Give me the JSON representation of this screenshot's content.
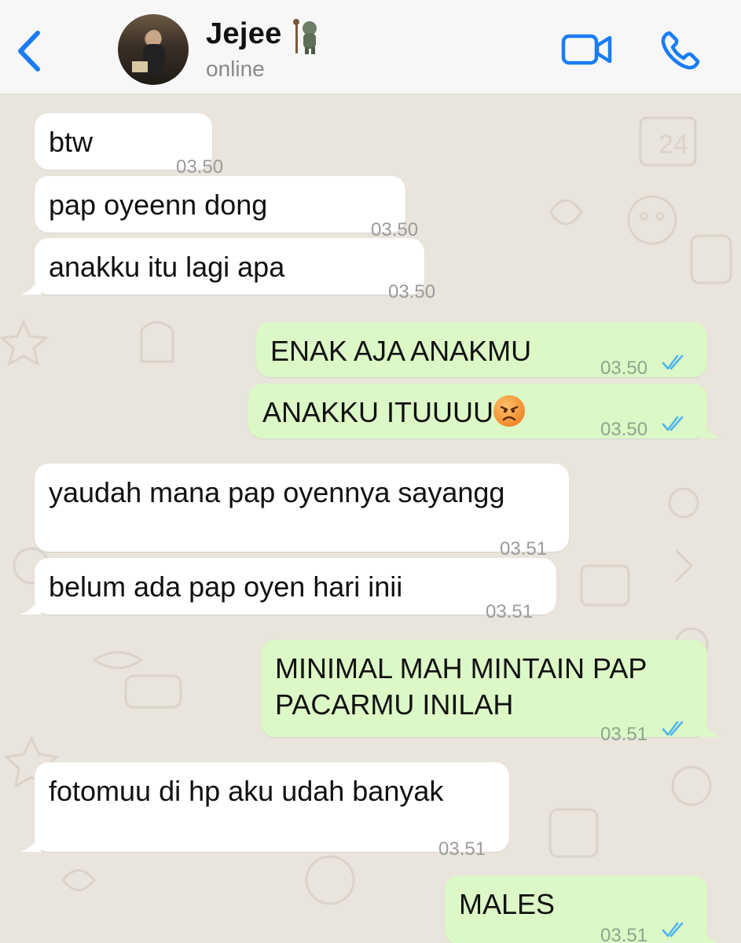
{
  "header": {
    "contact_name": "Jejee",
    "status": "online",
    "back_icon": "chevron-left-icon",
    "video_icon": "video-camera-icon",
    "call_icon": "phone-icon",
    "accent": "#1a7cf5"
  },
  "messages": [
    {
      "dir": "in",
      "text": "btw",
      "time": "03.50"
    },
    {
      "dir": "in",
      "text": "pap oyeenn dong",
      "time": "03.50"
    },
    {
      "dir": "in",
      "text": "anakku itu lagi apa",
      "time": "03.50"
    },
    {
      "dir": "out",
      "text": "ENAK AJA ANAKMU",
      "time": "03.50"
    },
    {
      "dir": "out",
      "text": "ANAKKU ITUUUU",
      "emoji": "angry-face",
      "time": "03.50"
    },
    {
      "dir": "in",
      "text": "yaudah mana pap oyennya sayangg",
      "time": "03.51"
    },
    {
      "dir": "in",
      "text": "belum ada pap oyen hari inii",
      "time": "03.51"
    },
    {
      "dir": "out",
      "text": "MINIMAL MAH MINTAIN PAP\nPACARMU INILAH",
      "time": "03.51"
    },
    {
      "dir": "in",
      "text": "fotomuu di hp aku udah banyak",
      "time": "03.51"
    },
    {
      "dir": "out",
      "text": "MALES",
      "time": "03.51"
    }
  ],
  "colors": {
    "incoming_bubble": "#ffffff",
    "outgoing_bubble": "#dcf8c6",
    "read_ticks": "#4fb5ee",
    "wallpaper": "#e9e4dc"
  }
}
